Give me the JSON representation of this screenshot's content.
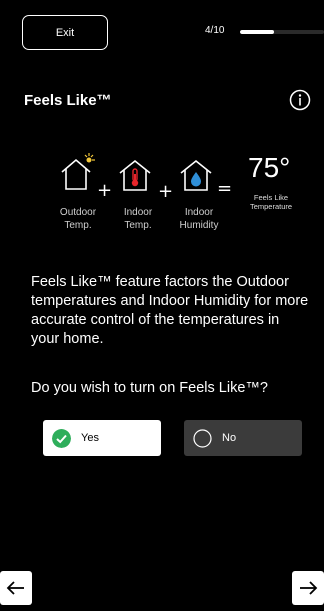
{
  "header": {
    "exit_label": "Exit",
    "progress_text": "4/10",
    "progress_fraction": 0.4
  },
  "page": {
    "title": "Feels Like™",
    "info_icon": "info-icon"
  },
  "equation": {
    "items": [
      {
        "icon": "house-sun-icon",
        "label_line1": "Outdoor",
        "label_line2": "Temp."
      },
      {
        "icon": "house-thermometer-icon",
        "label_line1": "Indoor",
        "label_line2": "Temp."
      },
      {
        "icon": "house-droplet-icon",
        "label_line1": "Indoor",
        "label_line2": "Humidity"
      }
    ],
    "plus": "+",
    "equals": "=",
    "result_value": "75°",
    "result_caption_line1": "Feels Like",
    "result_caption_line2": "Temperature"
  },
  "content": {
    "description": "Feels Like™ feature factors the Outdoor temperatures and Indoor Humidity for more accurate control of the temperatures in your home.",
    "question": "Do you wish to turn on Feels Like™?"
  },
  "options": [
    {
      "label": "Yes",
      "selected": true
    },
    {
      "label": "No",
      "selected": false
    }
  ],
  "colors": {
    "accent_green": "#2eae5b",
    "thermometer_red": "#e8252b",
    "droplet_blue": "#2f8fd8",
    "sun_yellow": "#f2c73a"
  },
  "nav": {
    "back_icon": "arrow-left-icon",
    "next_icon": "arrow-right-icon"
  }
}
